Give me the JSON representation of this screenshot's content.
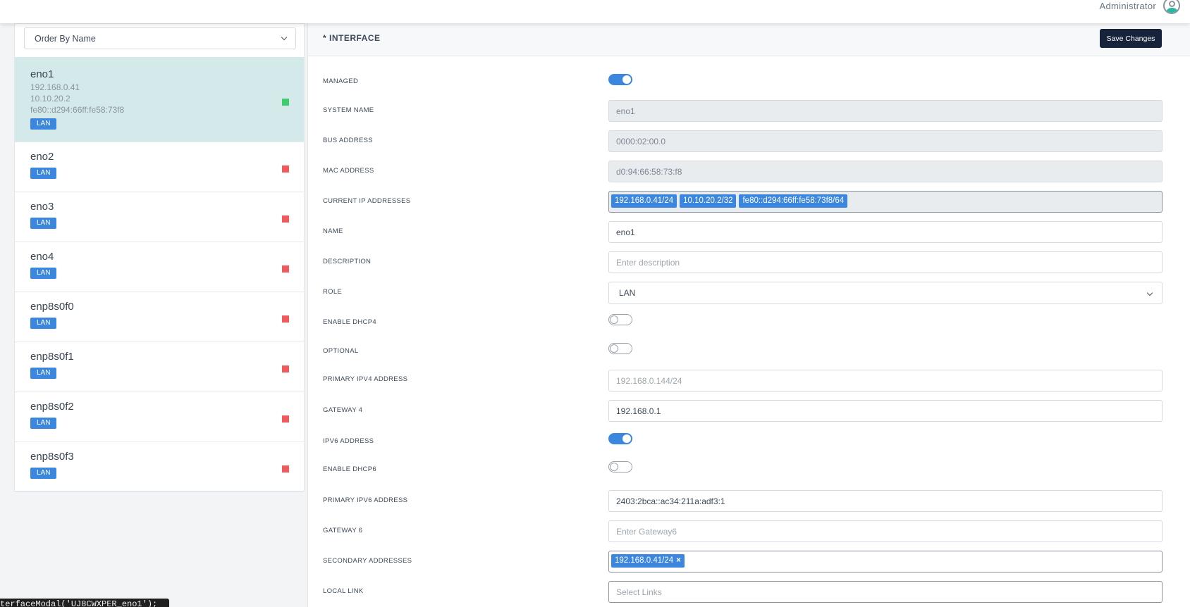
{
  "topbar": {
    "user": "Administrator",
    "avatar_icon": "user-avatar-icon"
  },
  "sidebar": {
    "order_select": "Order By Name",
    "interfaces": [
      {
        "name": "eno1",
        "addresses": [
          "192.168.0.41",
          "10.10.20.2",
          "fe80::d294:66ff:fe58:73f8"
        ],
        "role": "LAN",
        "status": "up",
        "selected": true
      },
      {
        "name": "eno2",
        "role": "LAN",
        "status": "down"
      },
      {
        "name": "eno3",
        "role": "LAN",
        "status": "down"
      },
      {
        "name": "eno4",
        "role": "LAN",
        "status": "down"
      },
      {
        "name": "enp8s0f0",
        "role": "LAN",
        "status": "down"
      },
      {
        "name": "enp8s0f1",
        "role": "LAN",
        "status": "down"
      },
      {
        "name": "enp8s0f2",
        "role": "LAN",
        "status": "down"
      },
      {
        "name": "enp8s0f3",
        "role": "LAN",
        "status": "down"
      }
    ]
  },
  "panel": {
    "title": "* INTERFACE",
    "save_label": "Save Changes",
    "labels": {
      "managed": "MANAGED",
      "system_name": "SYSTEM NAME",
      "bus_address": "BUS ADDRESS",
      "mac_address": "MAC ADDRESS",
      "current_ips": "CURRENT IP ADDRESSES",
      "name": "NAME",
      "description": "DESCRIPTION",
      "role": "ROLE",
      "enable_dhcp4": "ENABLE DHCP4",
      "optional": "OPTIONAL",
      "primary_ipv4": "PRIMARY IPV4 ADDRESS",
      "gateway4": "GATEWAY 4",
      "ipv6_address": "IPV6 ADDRESS",
      "enable_dhcp6": "ENABLE DHCP6",
      "primary_ipv6": "PRIMARY IPV6 ADDRESS",
      "gateway6": "GATEWAY 6",
      "secondary_addresses": "SECONDARY ADDRESSES",
      "local_link": "LOCAL LINK"
    },
    "values": {
      "managed": true,
      "system_name": "eno1",
      "bus_address": "0000:02:00.0",
      "mac_address": "d0:94:66:58:73:f8",
      "current_ips": [
        "192.168.0.41/24",
        "10.10.20.2/32",
        "fe80::d294:66ff:fe58:73f8/64"
      ],
      "name": "eno1",
      "description": "",
      "description_placeholder": "Enter description",
      "role": "LAN",
      "enable_dhcp4": false,
      "optional": false,
      "primary_ipv4": "",
      "primary_ipv4_placeholder": "192.168.0.144/24",
      "gateway4": "192.168.0.1",
      "ipv6_address": true,
      "enable_dhcp6": false,
      "primary_ipv6": "2403:2bca::ac34:211a:adf3:1",
      "gateway6": "",
      "gateway6_placeholder": "Enter Gateway6",
      "secondary_addresses": [
        "192.168.0.41/24"
      ],
      "remove_glyph": "×",
      "local_link_placeholder": "Select Links"
    }
  },
  "tooltip": "terfaceModal('UJ8CWXPER_eno1');",
  "colors": {
    "accent": "#3b86de",
    "selected_row": "#d4eaea",
    "status_up": "#3fcc6e",
    "status_down": "#ee5a5e",
    "save_button": "#16233a"
  }
}
